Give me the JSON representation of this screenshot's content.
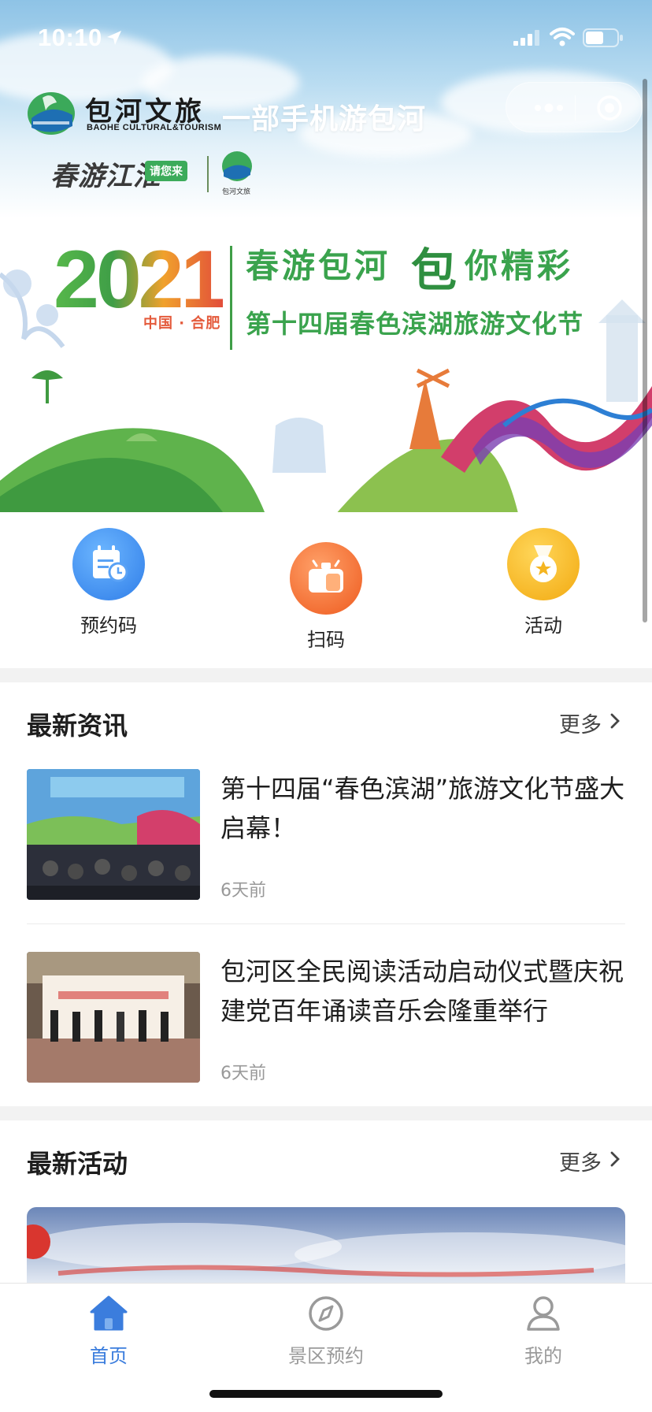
{
  "status_bar": {
    "time": "10:10"
  },
  "header": {
    "brand_name": "包河文旅",
    "brand_sub": "BAOHE CULTURAL&TOURISM",
    "slogan": "一部手机游包河",
    "spring_campaign": "春游江淮",
    "spring_tag": "请您来",
    "small_logo_text": "包河文旅"
  },
  "banner": {
    "year": "2021",
    "place": "中国 · 合肥",
    "title_a": "春游包河",
    "title_bao": "包",
    "title_b": "你精彩",
    "subtitle": "第十四届春色滨湖旅游文化节"
  },
  "quick_actions": [
    {
      "label": "预约码",
      "icon": "calendar-clock-icon",
      "color": "#3d8bf0"
    },
    {
      "label": "扫码",
      "icon": "scan-icon",
      "color": "#f06a2b"
    },
    {
      "label": "活动",
      "icon": "medal-icon",
      "color": "#f5b521"
    }
  ],
  "news": {
    "title": "最新资讯",
    "more": "更多",
    "items": [
      {
        "title": "第十四届“春色滨湖”旅游文化节盛大启幕！",
        "time": "6天前"
      },
      {
        "title": "包河区全民阅读活动启动仪式暨庆祝建党百年诵读音乐会隆重举行",
        "time": "6天前"
      }
    ]
  },
  "activities": {
    "title": "最新活动",
    "more": "更多"
  },
  "tabbar": {
    "items": [
      {
        "label": "首页",
        "icon": "home-icon",
        "active": true
      },
      {
        "label": "景区预约",
        "icon": "compass-icon",
        "active": false
      },
      {
        "label": "我的",
        "icon": "user-icon",
        "active": false
      }
    ]
  },
  "colors": {
    "accent": "#3b7ddd",
    "brand_green": "#3aa34d"
  }
}
